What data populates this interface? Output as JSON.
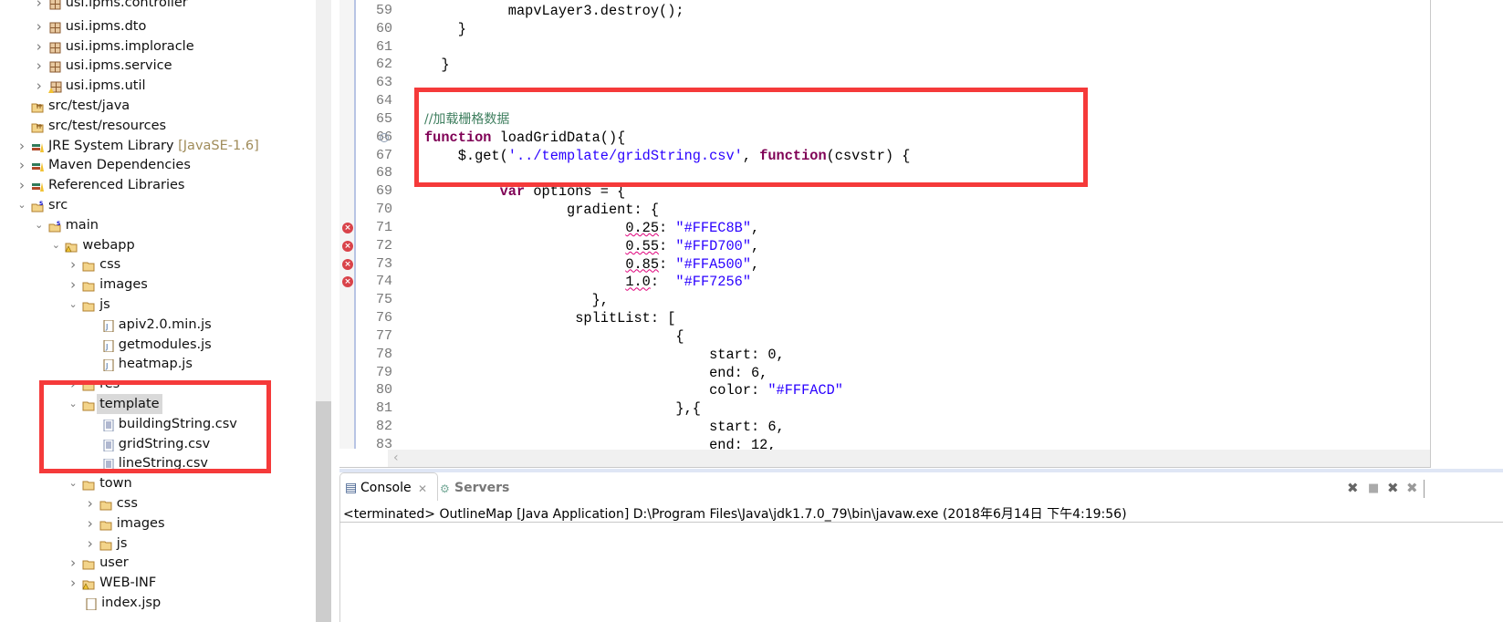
{
  "explorer": {
    "items": [
      {
        "label": "usi.ipms.controller",
        "depth": 1,
        "icon": "package-icon",
        "state": "collapsed",
        "partial": true
      },
      {
        "label": "usi.ipms.dto",
        "depth": 1,
        "icon": "package-icon",
        "state": "collapsed"
      },
      {
        "label": "usi.ipms.imploracle",
        "depth": 1,
        "icon": "package-icon",
        "state": "collapsed"
      },
      {
        "label": "usi.ipms.service",
        "depth": 1,
        "icon": "package-icon",
        "state": "collapsed"
      },
      {
        "label": "usi.ipms.util",
        "depth": 1,
        "icon": "package-warning-icon",
        "state": "collapsed"
      },
      {
        "label": "src/test/java",
        "depth": 0,
        "icon": "source-folder-icon",
        "state": "none"
      },
      {
        "label": "src/test/resources",
        "depth": 0,
        "icon": "source-folder-icon",
        "state": "none"
      },
      {
        "label": "JRE System Library",
        "decoration": "[JavaSE-1.6]",
        "depth": 0,
        "icon": "library-icon",
        "state": "collapsed"
      },
      {
        "label": "Maven Dependencies",
        "depth": 0,
        "icon": "library-icon",
        "state": "collapsed"
      },
      {
        "label": "Referenced Libraries",
        "depth": 0,
        "icon": "library-icon",
        "state": "collapsed"
      },
      {
        "label": "src",
        "depth": 0,
        "icon": "svn-folder-icon",
        "state": "expanded"
      },
      {
        "label": "main",
        "depth": 1,
        "icon": "svn-folder-icon",
        "state": "expanded"
      },
      {
        "label": "webapp",
        "depth": 2,
        "icon": "folder-warning-icon",
        "state": "expanded"
      },
      {
        "label": "css",
        "depth": 3,
        "icon": "folder-icon",
        "state": "collapsed"
      },
      {
        "label": "images",
        "depth": 3,
        "icon": "folder-icon",
        "state": "collapsed"
      },
      {
        "label": "js",
        "depth": 3,
        "icon": "folder-icon",
        "state": "expanded"
      },
      {
        "label": "apiv2.0.min.js",
        "depth": 4,
        "icon": "js-file-icon",
        "state": "file"
      },
      {
        "label": "getmodules.js",
        "depth": 4,
        "icon": "js-file-icon",
        "state": "file"
      },
      {
        "label": "heatmap.js",
        "depth": 4,
        "icon": "js-file-icon",
        "state": "file"
      },
      {
        "label": "res",
        "depth": 3,
        "icon": "folder-icon",
        "state": "collapsed"
      },
      {
        "label": "template",
        "depth": 3,
        "icon": "folder-icon",
        "state": "expanded",
        "selected": true
      },
      {
        "label": "buildingString.csv",
        "depth": 4,
        "icon": "text-file-icon",
        "state": "file"
      },
      {
        "label": "gridString.csv",
        "depth": 4,
        "icon": "text-file-icon",
        "state": "file"
      },
      {
        "label": "lineString.csv",
        "depth": 4,
        "icon": "text-file-icon",
        "state": "file"
      },
      {
        "label": "town",
        "depth": 3,
        "icon": "folder-icon",
        "state": "expanded"
      },
      {
        "label": "css",
        "depth": 4,
        "icon": "folder-icon",
        "state": "collapsed"
      },
      {
        "label": "images",
        "depth": 4,
        "icon": "folder-icon",
        "state": "collapsed"
      },
      {
        "label": "js",
        "depth": 4,
        "icon": "folder-icon",
        "state": "collapsed"
      },
      {
        "label": "user",
        "depth": 3,
        "icon": "folder-icon",
        "state": "collapsed"
      },
      {
        "label": "WEB-INF",
        "depth": 3,
        "icon": "folder-warning-icon",
        "state": "collapsed"
      },
      {
        "label": "index.jsp",
        "depth": 3,
        "icon": "jsp-file-icon",
        "state": "file",
        "partial": true
      }
    ]
  },
  "editor": {
    "lines": [
      {
        "n": "59",
        "parts": [
          {
            "t": "          mapvLayer3.destroy();"
          }
        ]
      },
      {
        "n": "60",
        "parts": [
          {
            "t": "    }"
          }
        ]
      },
      {
        "n": "61",
        "parts": []
      },
      {
        "n": "62",
        "parts": [
          {
            "t": "  }"
          }
        ]
      },
      {
        "n": "63",
        "parts": []
      },
      {
        "n": "64",
        "parts": []
      },
      {
        "n": "65",
        "parts": [
          {
            "t": "//加载栅格数据",
            "c": "cm"
          }
        ]
      },
      {
        "n": "66",
        "fold": true,
        "parts": [
          {
            "t": "function",
            "c": "kw"
          },
          {
            "t": " loadGridData(){"
          }
        ]
      },
      {
        "n": "67",
        "parts": [
          {
            "t": "    $.get("
          },
          {
            "t": "'../template/gridString.csv'",
            "c": "str"
          },
          {
            "t": ", "
          },
          {
            "t": "function",
            "c": "kw"
          },
          {
            "t": "(csvstr) {"
          }
        ]
      },
      {
        "n": "68",
        "parts": []
      },
      {
        "n": "69",
        "parts": [
          {
            "t": "         "
          },
          {
            "t": "var",
            "c": "kw"
          },
          {
            "t": " options = {"
          }
        ]
      },
      {
        "n": "70",
        "parts": [
          {
            "t": "                 gradient: {"
          }
        ]
      },
      {
        "n": "71",
        "error": true,
        "parts": [
          {
            "t": "                        "
          },
          {
            "t": "0.25",
            "c": "err"
          },
          {
            "t": ": "
          },
          {
            "t": "\"#FFEC8B\"",
            "c": "str"
          },
          {
            "t": ","
          }
        ]
      },
      {
        "n": "72",
        "error": true,
        "parts": [
          {
            "t": "                        "
          },
          {
            "t": "0.55",
            "c": "err"
          },
          {
            "t": ": "
          },
          {
            "t": "\"#FFD700\"",
            "c": "str"
          },
          {
            "t": ","
          }
        ]
      },
      {
        "n": "73",
        "error": true,
        "parts": [
          {
            "t": "                        "
          },
          {
            "t": "0.85",
            "c": "err"
          },
          {
            "t": ": "
          },
          {
            "t": "\"#FFA500\"",
            "c": "str"
          },
          {
            "t": ","
          }
        ]
      },
      {
        "n": "74",
        "error": true,
        "parts": [
          {
            "t": "                        "
          },
          {
            "t": "1.0",
            "c": "err"
          },
          {
            "t": ":  "
          },
          {
            "t": "\"#FF7256\"",
            "c": "str"
          }
        ]
      },
      {
        "n": "75",
        "parts": [
          {
            "t": "                    },"
          }
        ]
      },
      {
        "n": "76",
        "parts": [
          {
            "t": "                  splitList: ["
          }
        ]
      },
      {
        "n": "77",
        "parts": [
          {
            "t": "                              {"
          }
        ]
      },
      {
        "n": "78",
        "parts": [
          {
            "t": "                                  start: 0,"
          }
        ]
      },
      {
        "n": "79",
        "parts": [
          {
            "t": "                                  end: 6,"
          }
        ]
      },
      {
        "n": "80",
        "parts": [
          {
            "t": "                                  color: "
          },
          {
            "t": "\"#FFFACD\"",
            "c": "str"
          }
        ]
      },
      {
        "n": "81",
        "parts": [
          {
            "t": "                              },{"
          }
        ]
      },
      {
        "n": "82",
        "parts": [
          {
            "t": "                                  start: 6,"
          }
        ]
      },
      {
        "n": "83",
        "parts": [
          {
            "t": "                                  end: 12,"
          }
        ]
      }
    ]
  },
  "console": {
    "tab_label": "Console",
    "servers_label": "Servers",
    "output": "<terminated> OutlineMap [Java Application] D:\\Program Files\\Java\\jdk1.7.0_79\\bin\\javaw.exe (2018年6月14日 下午4:19:56)"
  },
  "colors": {
    "highlight": "#f53a3a",
    "keyword": "#7f0055",
    "string": "#2a00ff",
    "comment": "#3f7f5f"
  }
}
